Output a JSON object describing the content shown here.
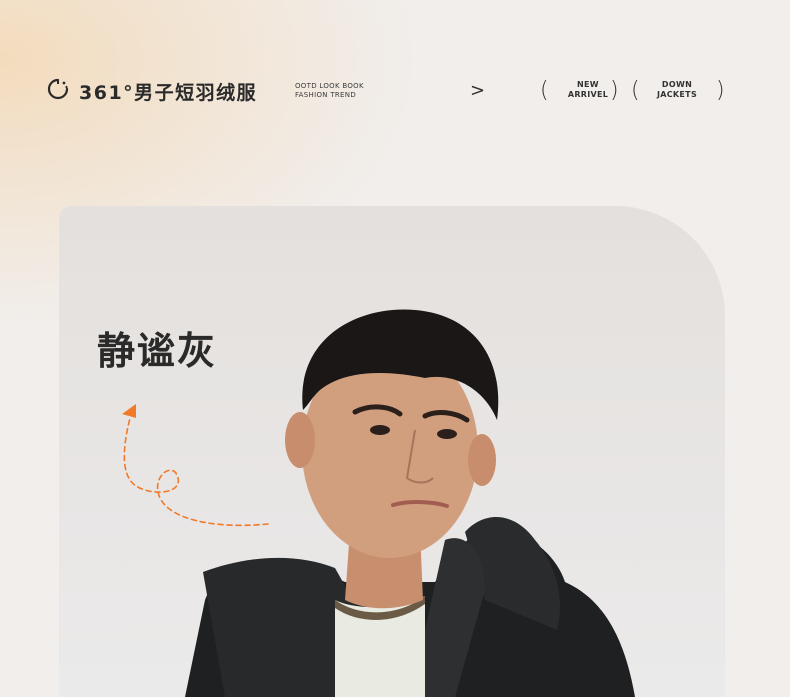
{
  "header": {
    "brand_icon": "loading-circle-icon",
    "brand_title": "361°男子短羽绒服",
    "tagline_line1": "OOTD LOOK BOOK",
    "tagline_line2": "FASHION TREND",
    "arrow_label": ">",
    "pill1_line1": "NEW",
    "pill1_line2": "ARRIVEL",
    "pill2_line1": "DOWN",
    "pill2_line2": "JACKETS",
    "paren_open": "(",
    "paren_close": ")"
  },
  "product": {
    "color_name": "静谧灰",
    "accent_color": "#f07a28",
    "photo_subject": "male-model-black-down-jacket"
  }
}
